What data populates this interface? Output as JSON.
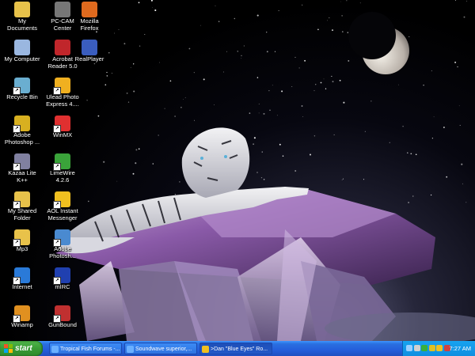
{
  "desktop": {
    "icons": [
      {
        "label": "My Documents",
        "icon": "my-documents-icon",
        "color": "#e8c24a"
      },
      {
        "label": "PC-CAM Center",
        "icon": "camera-icon",
        "color": "#777777"
      },
      {
        "label": "Mozilla Firefox",
        "icon": "firefox-icon",
        "color": "#e06a1e"
      },
      {
        "label": "My Computer",
        "icon": "my-computer-icon",
        "color": "#9ab7e0"
      },
      {
        "label": "Acrobat Reader 5.0",
        "icon": "acrobat-icon",
        "color": "#c0262b"
      },
      {
        "label": "RealPlayer",
        "icon": "realplayer-icon",
        "color": "#3a5dbe"
      },
      {
        "label": "Recycle Bin",
        "icon": "recycle-bin-icon",
        "color": "#6aaed0"
      },
      {
        "label": "Ulead Photo Express 4....",
        "icon": "ulead-icon",
        "color": "#f0b020"
      },
      {
        "label": "Adobe Photoshop ...",
        "icon": "photoshop-icon",
        "color": "#d8b020"
      },
      {
        "label": "WinMX",
        "icon": "winmx-icon",
        "color": "#e03030"
      },
      {
        "label": "Kazaa Lite K++",
        "icon": "kazaa-icon",
        "color": "#8080a0"
      },
      {
        "label": "LimeWire 4.2.6",
        "icon": "limewire-icon",
        "color": "#3aa33a"
      },
      {
        "label": "My Shared Folder",
        "icon": "shared-folder-icon",
        "color": "#e8c24a"
      },
      {
        "label": "AOL Instant Messenger",
        "icon": "aim-icon",
        "color": "#f0c020"
      },
      {
        "label": "Mp3",
        "icon": "folder-icon",
        "color": "#e8c24a"
      },
      {
        "label": "Adobe Photosh...",
        "icon": "photoshop-icon",
        "color": "#4a8ad0"
      },
      {
        "label": "Internet",
        "icon": "internet-explorer-icon",
        "color": "#2a7ad8"
      },
      {
        "label": "mIRC",
        "icon": "mirc-icon",
        "color": "#2040b0"
      },
      {
        "label": "Winamp",
        "icon": "winamp-icon",
        "color": "#e09020"
      },
      {
        "label": "GunBound",
        "icon": "gunbound-icon",
        "color": "#c03030"
      }
    ]
  },
  "taskbar": {
    "start_label": "start",
    "tasks": [
      {
        "label": "Tropical Fish Forums -...",
        "icon": "internet-explorer-icon",
        "color": "#6ab0ff",
        "active": false
      },
      {
        "label": "Soundwave superior,...",
        "icon": "internet-explorer-icon",
        "color": "#6ab0ff",
        "active": false
      },
      {
        "label": ">Dan \"Blue Eyes\" Ro...",
        "icon": "chat-window-icon",
        "color": "#f0c020",
        "active": true
      }
    ],
    "tray": {
      "icons": [
        {
          "icon": "network-icon",
          "color": "#9ad0ff"
        },
        {
          "icon": "volume-icon",
          "color": "#d0d0d0"
        },
        {
          "icon": "messenger-icon",
          "color": "#3ab03a"
        },
        {
          "icon": "antivirus-icon",
          "color": "#e0c020"
        },
        {
          "icon": "aim-tray-icon",
          "color": "#f0c020"
        },
        {
          "icon": "shield-icon",
          "color": "#d04040"
        }
      ],
      "clock": "7:27 AM"
    }
  },
  "colors": {
    "taskbar_blue": "#245edb",
    "start_green": "#3a9c36",
    "tray_blue": "#0f8ee0"
  }
}
